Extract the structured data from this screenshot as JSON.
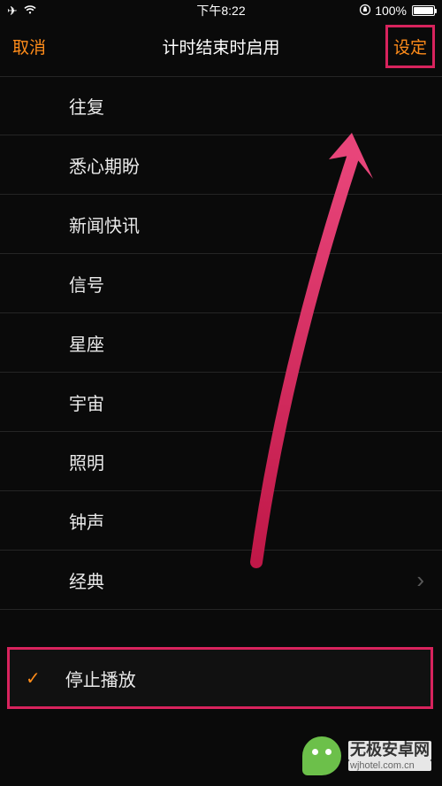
{
  "status": {
    "time": "下午8:22",
    "battery_pct": "100%"
  },
  "nav": {
    "cancel": "取消",
    "title": "计时结束时启用",
    "set": "设定"
  },
  "list": [
    {
      "label": "往复",
      "has_chevron": false
    },
    {
      "label": "悉心期盼",
      "has_chevron": false
    },
    {
      "label": "新闻快讯",
      "has_chevron": false
    },
    {
      "label": "信号",
      "has_chevron": false
    },
    {
      "label": "星座",
      "has_chevron": false
    },
    {
      "label": "宇宙",
      "has_chevron": false
    },
    {
      "label": "照明",
      "has_chevron": false
    },
    {
      "label": "钟声",
      "has_chevron": false
    },
    {
      "label": "经典",
      "has_chevron": true
    }
  ],
  "stop": {
    "label": "停止播放",
    "checked": true
  },
  "watermark": {
    "main": "无极安卓网",
    "sub": "wjhotel.com.cn"
  }
}
